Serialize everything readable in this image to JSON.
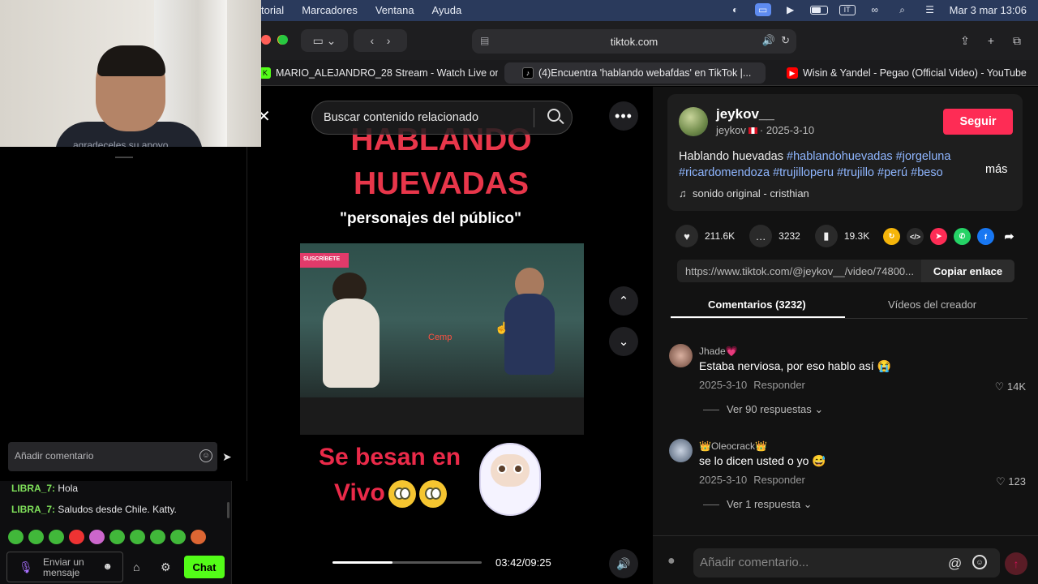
{
  "menubar": {
    "menus": [
      "torial",
      "Marcadores",
      "Ventana",
      "Ayuda"
    ],
    "datetime": "Mar 3 mar 13:06",
    "input_source": "IT"
  },
  "browser": {
    "url": "tiktok.com",
    "tabs": [
      {
        "title": "MARIO_ALEJANDRO_28 Stream - Watch Live on...",
        "favicon": "kick-icon",
        "active": false
      },
      {
        "title": "(4)Encuentra 'hablando webafdas' en TikTok |...",
        "favicon": "tiktok-icon",
        "active": true
      },
      {
        "title": "Wisin & Yandel - Pegao (Official Video) - YouTube",
        "favicon": "youtube-icon",
        "active": false
      }
    ]
  },
  "stream_overlay": {
    "webcam_caption": "agradeceles su apoyo.",
    "comment_placeholder": "Añadir comentario",
    "messages": [
      {
        "user": "LIBRA_7:",
        "text": "Hola"
      },
      {
        "user": "LIBRA_7:",
        "text": "Saludos desde Chile. Katty."
      }
    ],
    "send_placeholder": "Enviar un mensaje",
    "chat_button": "Chat"
  },
  "video": {
    "search_placeholder": "Buscar contenido relacionado",
    "title_line1": "HABLANDO",
    "title_line2": "HUEVADAS",
    "subtitle": "\"personajes del público\"",
    "clip_banner": "SUSCRÍBETE",
    "clip_text": "Cemp",
    "caption_line1": "Se besan en",
    "caption_line2": "Vivo",
    "progress_fraction": 0.4,
    "time": "03:42/09:25"
  },
  "post": {
    "username": "jeykov__",
    "handle": "jeykov",
    "date": "2025-3-10",
    "follow_label": "Seguir",
    "description": "Hablando huevadas",
    "hashtags_line1": "#hablandohuevadas #jorgeluna",
    "hashtags_line2": "#ricardomendoza #trujilloperu #trujillo #perú #beso",
    "more_label": "más",
    "sound": "sonido original - cristhian",
    "likes": "211.6K",
    "comments": "3232",
    "saves": "19.3K",
    "link": "https://www.tiktok.com/@jeykov__/video/74800...",
    "copy_label": "Copiar enlace",
    "tab_comments": "Comentarios (3232)",
    "tab_videos": "Vídeos del creador"
  },
  "comments": [
    {
      "user": "Jhade💗",
      "text": "Estaba nerviosa, por eso hablo así 😭",
      "date": "2025-3-10",
      "reply": "Responder",
      "likes": "14K",
      "replies": "Ver 90 respuestas"
    },
    {
      "user": "👑Oleocrack👑",
      "text": "se lo dicen usted o yo 😅",
      "date": "2025-3-10",
      "reply": "Responder",
      "likes": "123",
      "replies": "Ver 1 respuesta"
    }
  ],
  "comment_input": {
    "placeholder": "Añadir comentario..."
  }
}
